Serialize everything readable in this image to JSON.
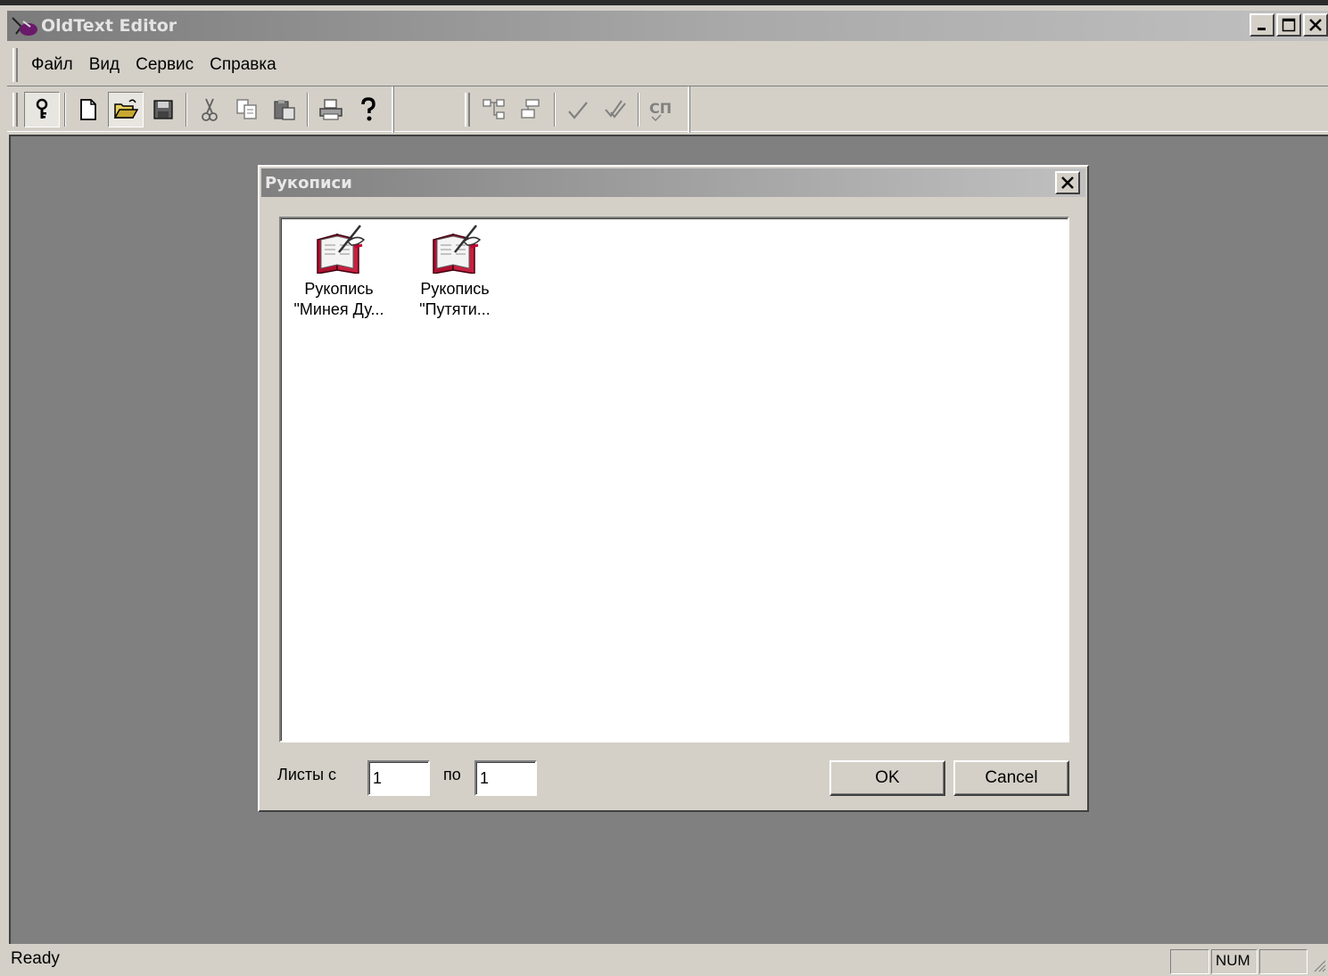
{
  "app": {
    "title": "OldText Editor",
    "window_controls": [
      "minimize",
      "maximize",
      "close"
    ]
  },
  "menu": {
    "items": [
      {
        "label": "Файл"
      },
      {
        "label": "Вид"
      },
      {
        "label": "Сервис"
      },
      {
        "label": "Справка"
      }
    ]
  },
  "toolbar": {
    "buttons": [
      "key-icon",
      "new-file-icon",
      "open-folder-icon",
      "save-icon",
      "cut-icon",
      "copy-icon",
      "paste-icon",
      "print-icon",
      "help-icon",
      "tree-expand-icon",
      "tree-collapse-icon",
      "check-icon",
      "double-check-icon",
      "cp-icon"
    ]
  },
  "dialog": {
    "title": "Рукописи",
    "items": [
      {
        "label": "Рукопись\n\"Минея Ду..."
      },
      {
        "label": "Рукопись\n\"Путяти..."
      }
    ],
    "sheets_from_label": "Листы с",
    "sheets_from_value": "1",
    "sheets_to_label": "по",
    "sheets_to_value": "1",
    "ok_label": "OK",
    "cancel_label": "Cancel"
  },
  "status": {
    "text": "Ready",
    "num_indicator": "NUM"
  },
  "colors": {
    "face": "#d4d0c8",
    "client": "#808080",
    "icon_red": "#b01030"
  }
}
